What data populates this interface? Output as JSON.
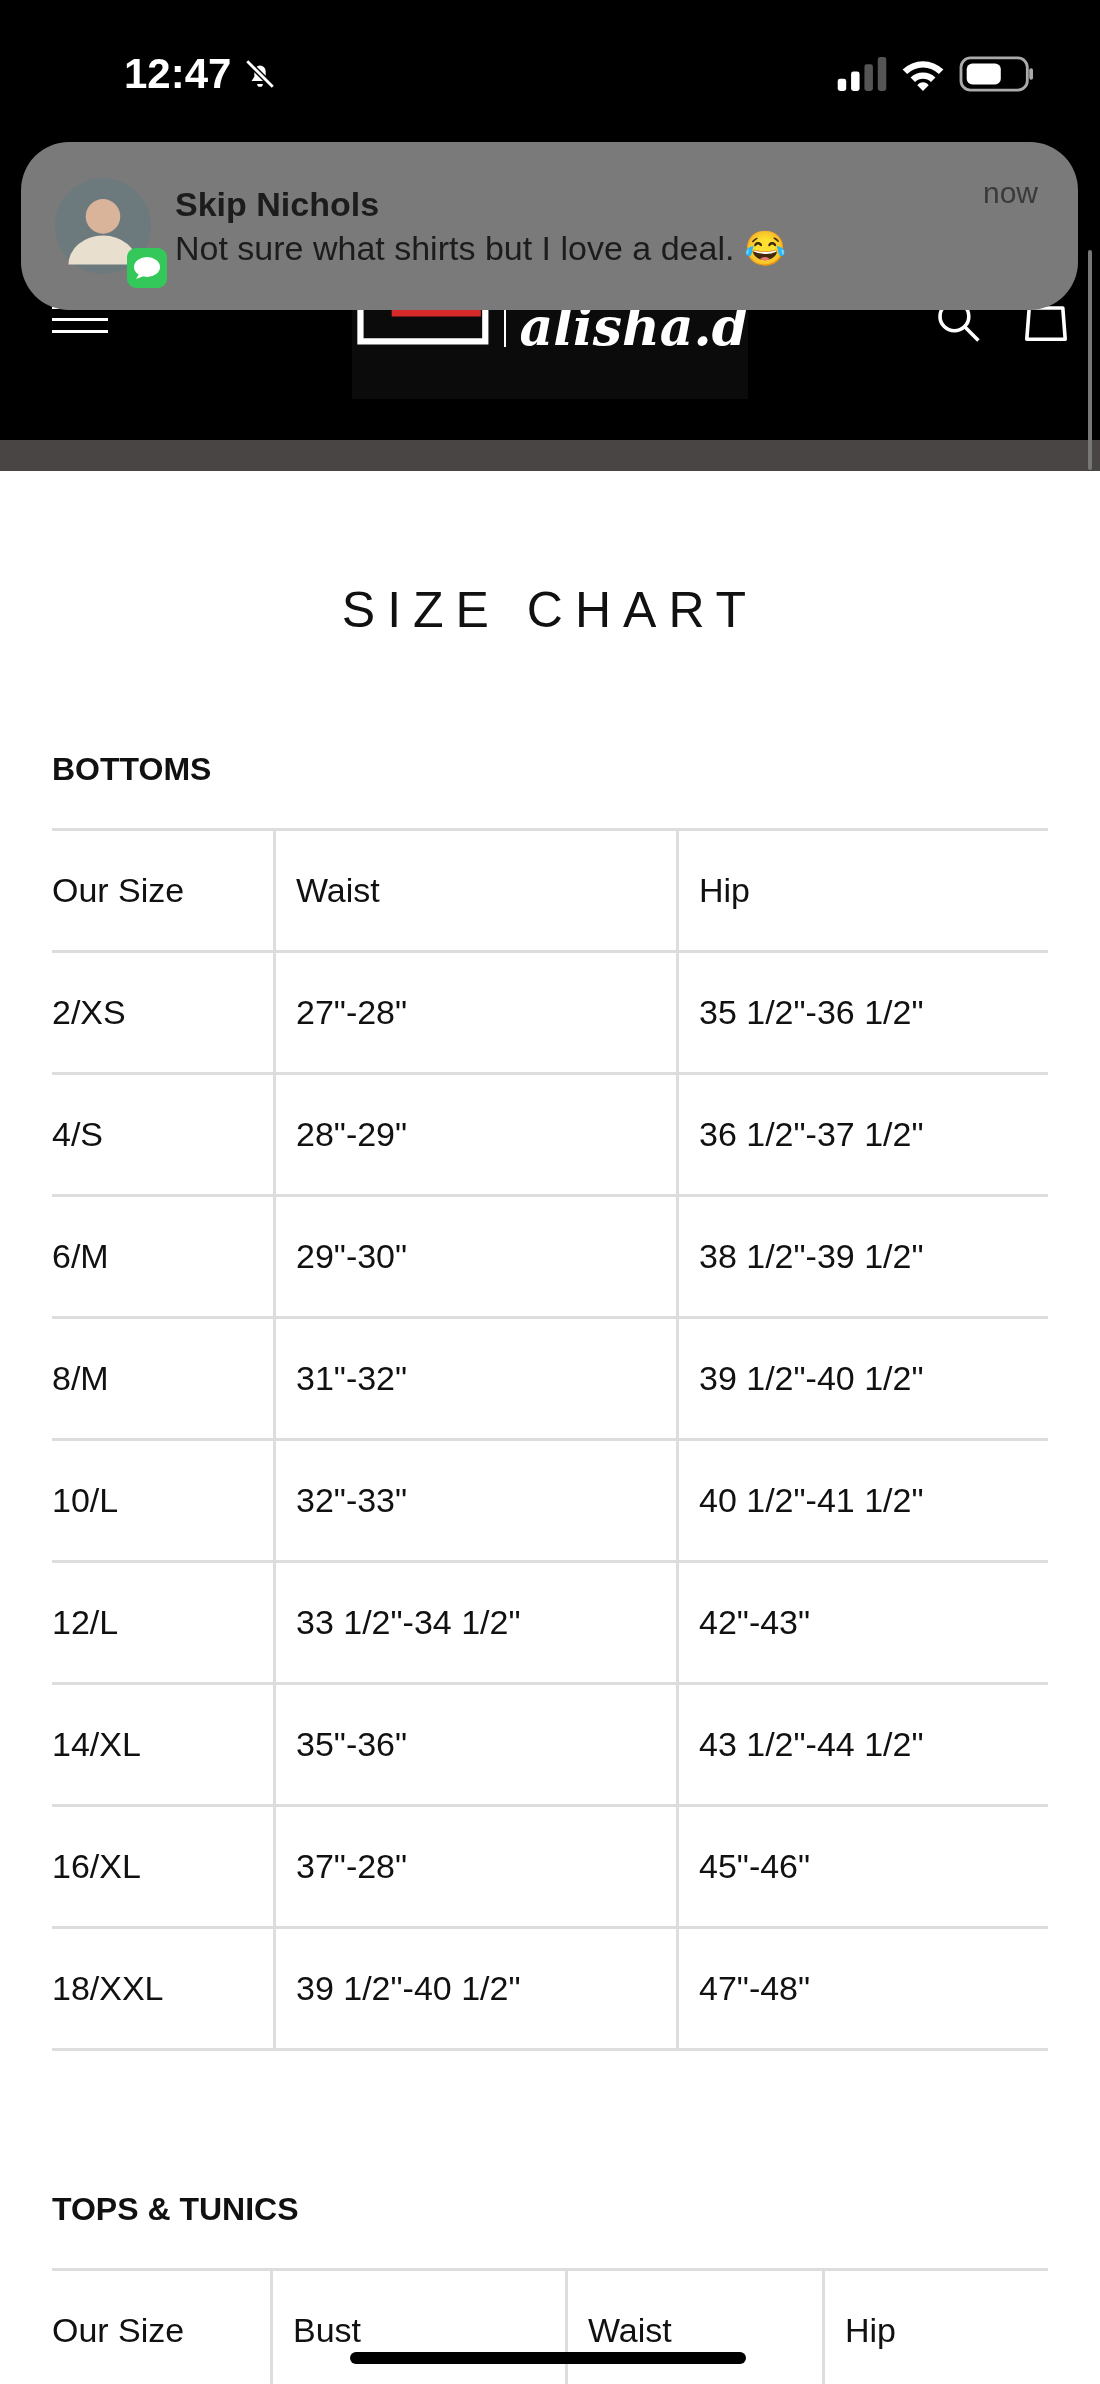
{
  "status_bar": {
    "time": "12:47",
    "silent": true
  },
  "notification": {
    "sender": "Skip Nichols",
    "time": "now",
    "message": "Not sure what shirts but I love a deal. 😂"
  },
  "header": {
    "logo_text": "alisha.d"
  },
  "page_title": "SIZE CHART",
  "sections": [
    {
      "title": "BOTTOMS",
      "columns": [
        "Our Size",
        "Waist",
        "Hip"
      ],
      "rows": [
        [
          "2/XS",
          "27\"-28\"",
          "35 1/2\"-36 1/2\""
        ],
        [
          "4/S",
          "28\"-29\"",
          "36 1/2\"-37 1/2\""
        ],
        [
          "6/M",
          "29\"-30\"",
          "38 1/2\"-39 1/2\""
        ],
        [
          "8/M",
          "31\"-32\"",
          "39 1/2\"-40 1/2\""
        ],
        [
          "10/L",
          "32\"-33\"",
          "40 1/2\"-41 1/2\""
        ],
        [
          "12/L",
          "33 1/2\"-34 1/2\"",
          "42\"-43\""
        ],
        [
          "14/XL",
          "35\"-36\"",
          "43 1/2\"-44 1/2\""
        ],
        [
          "16/XL",
          "37\"-28\"",
          "45\"-46\""
        ],
        [
          "18/XXL",
          "39 1/2\"-40 1/2\"",
          "47\"-48\""
        ]
      ]
    },
    {
      "title": "TOPS & TUNICS",
      "columns": [
        "Our Size",
        "Bust",
        "Waist",
        "Hip"
      ]
    }
  ]
}
